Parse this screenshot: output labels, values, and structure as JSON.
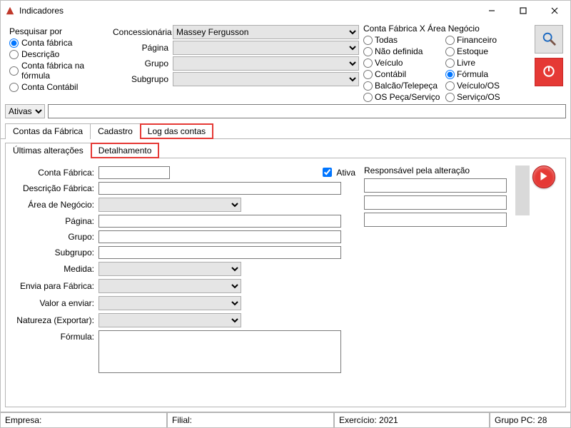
{
  "window": {
    "title": "Indicadores"
  },
  "search": {
    "legend": "Pesquisar por",
    "options": [
      "Conta fábrica",
      "Descrição",
      "Conta fábrica na fórmula",
      "Conta Contábil"
    ],
    "selected": 0
  },
  "filters": {
    "concessionaria_label": "Concessionária",
    "concessionaria_value": "Massey Fergusson",
    "pagina_label": "Página",
    "grupo_label": "Grupo",
    "subgrupo_label": "Subgrupo"
  },
  "area_negocio": {
    "legend": "Conta Fábrica X Área Negócio",
    "col1": [
      "Todas",
      "Não definida",
      "Veículo",
      "Contábil",
      "Balcão/Telepeça",
      "OS Peça/Serviço"
    ],
    "col2": [
      "Financeiro",
      "Estoque",
      "Livre",
      "Fórmula",
      "Veículo/OS",
      "Serviço/OS"
    ],
    "selected_col": 2,
    "selected_idx": 3
  },
  "state_dropdown": {
    "value": "Ativas"
  },
  "search_input": {
    "value": ""
  },
  "tabs_main": {
    "items": [
      "Contas da Fábrica",
      "Cadastro",
      "Log das contas"
    ],
    "active": 2
  },
  "tabs_sub": {
    "items": [
      "Últimas alterações",
      "Detalhamento"
    ],
    "active": 1
  },
  "form": {
    "conta_fabrica_label": "Conta Fábrica:",
    "ativa_label": "Ativa",
    "ativa_checked": true,
    "descricao_label": "Descrição Fábrica:",
    "area_label": "Área de Negócio:",
    "pagina_label": "Página:",
    "grupo_label": "Grupo:",
    "subgrupo_label": "Subgrupo:",
    "medida_label": "Medida:",
    "envia_label": "Envia para Fábrica:",
    "valor_label": "Valor a enviar:",
    "natureza_label": "Natureza (Exportar):",
    "formula_label": "Fórmula:"
  },
  "responsible": {
    "legend": "Responsável pela alteração",
    "f1": "",
    "f2": "",
    "f3": ""
  },
  "statusbar": {
    "empresa_label": "Empresa:",
    "filial_label": "Filial:",
    "exercicio_label": "Exercício: 2021",
    "grupopc_label": "Grupo PC: 28"
  }
}
